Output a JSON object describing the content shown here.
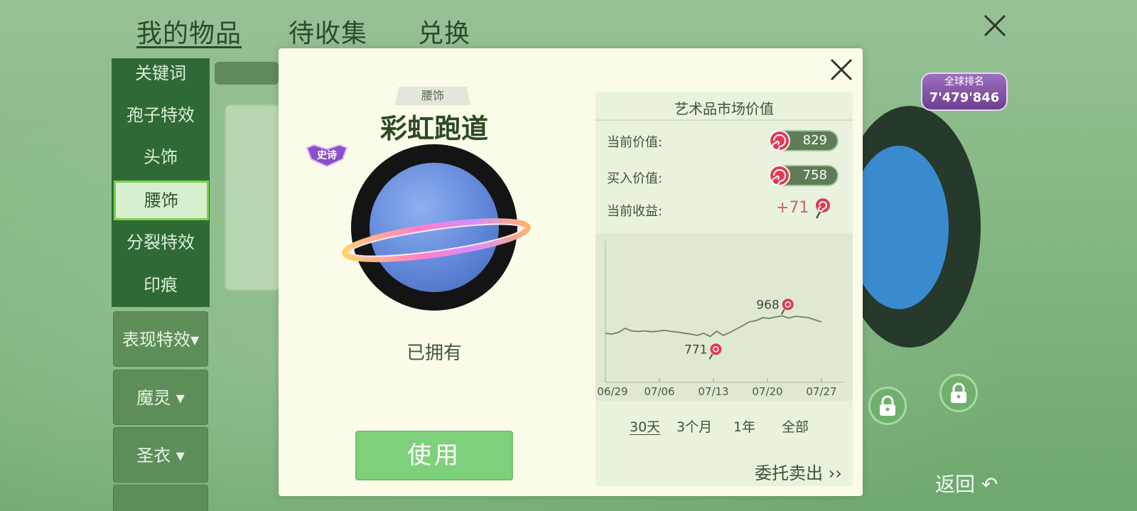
{
  "top_tabs": [
    {
      "label": "我的物品"
    },
    {
      "label": "待收集"
    },
    {
      "label": "兑换"
    }
  ],
  "sidebar": {
    "items": [
      {
        "label": "关键词"
      },
      {
        "label": "孢子特效"
      },
      {
        "label": "头饰"
      },
      {
        "label": "腰饰",
        "active": true
      },
      {
        "label": "分裂特效"
      },
      {
        "label": "印痕"
      }
    ],
    "dropdowns": [
      {
        "label": "表现特效▾"
      },
      {
        "label": "魔灵 ▾"
      },
      {
        "label": "圣衣 ▾"
      }
    ]
  },
  "rank_badge": {
    "title": "全球排名",
    "value": "7'479'846"
  },
  "back_button": {
    "label": "返回"
  },
  "modal": {
    "category": "腰饰",
    "title": "彩虹跑道",
    "rarity_badge": "史诗",
    "status": "已拥有",
    "use_button": "使用"
  },
  "market": {
    "title": "艺术品市场价值",
    "current_value_label": "当前价值:",
    "current_value": "829",
    "buy_value_label": "买入价值:",
    "buy_value": "758",
    "gain_label": "当前收益:",
    "gain_value": "+71",
    "range_options": [
      {
        "label": "30天",
        "active": true
      },
      {
        "label": "3个月"
      },
      {
        "label": "1年"
      },
      {
        "label": "全部"
      }
    ],
    "consign_label": "委托卖出 ››"
  },
  "colors": {
    "accent_green": "#7ed07b",
    "sidebar_green": "#2f6a36",
    "gain_red": "#d0645a"
  },
  "chart_data": {
    "type": "line",
    "x_ticks": [
      "06/29",
      "07/06",
      "07/13",
      "07/20",
      "07/27"
    ],
    "series": [
      {
        "values": [
          845,
          840,
          852,
          880,
          862,
          858,
          862,
          856,
          860,
          866,
          858,
          854,
          846,
          840,
          830,
          846,
          823,
          860,
          830,
          851,
          875,
          900,
          926,
          934,
          955,
          950,
          960,
          968,
          952,
          965,
          960,
          955,
          940,
          925
        ]
      }
    ],
    "annotations": [
      {
        "label": "968",
        "type": "max"
      },
      {
        "label": "771",
        "type": "min"
      }
    ],
    "ylim": [
      500,
      1500
    ],
    "grid": false
  }
}
